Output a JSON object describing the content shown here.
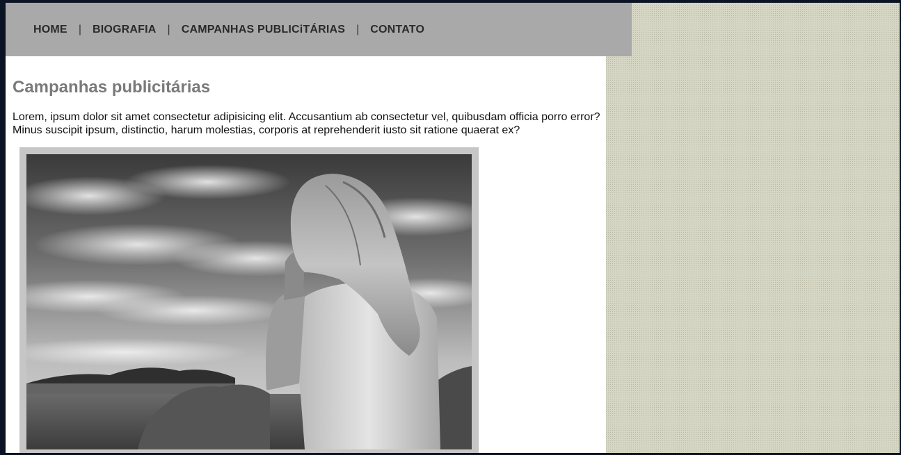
{
  "nav": {
    "items": [
      {
        "label": "HOME"
      },
      {
        "label": "BIOGRAFIA"
      },
      {
        "label": "CAMPANHAS PUBLICiTÁRIAS"
      },
      {
        "label": "CONTATO"
      }
    ],
    "separator": "|"
  },
  "main": {
    "title": "Campanhas publicitárias",
    "paragraph": "Lorem, ipsum dolor sit amet consectetur adipisicing elit. Accusantium ab consectetur vel, quibusdam officia porro error? Minus suscipit ipsum, distinctio, harum molestias, corporis at reprehenderit iusto sit ratione quaerat ex?"
  },
  "colors": {
    "navbar": "#a9a9a9",
    "page_background": "#d6d6c4",
    "title": "#7a7a7a",
    "photo_frame": "#c6c6c6"
  }
}
